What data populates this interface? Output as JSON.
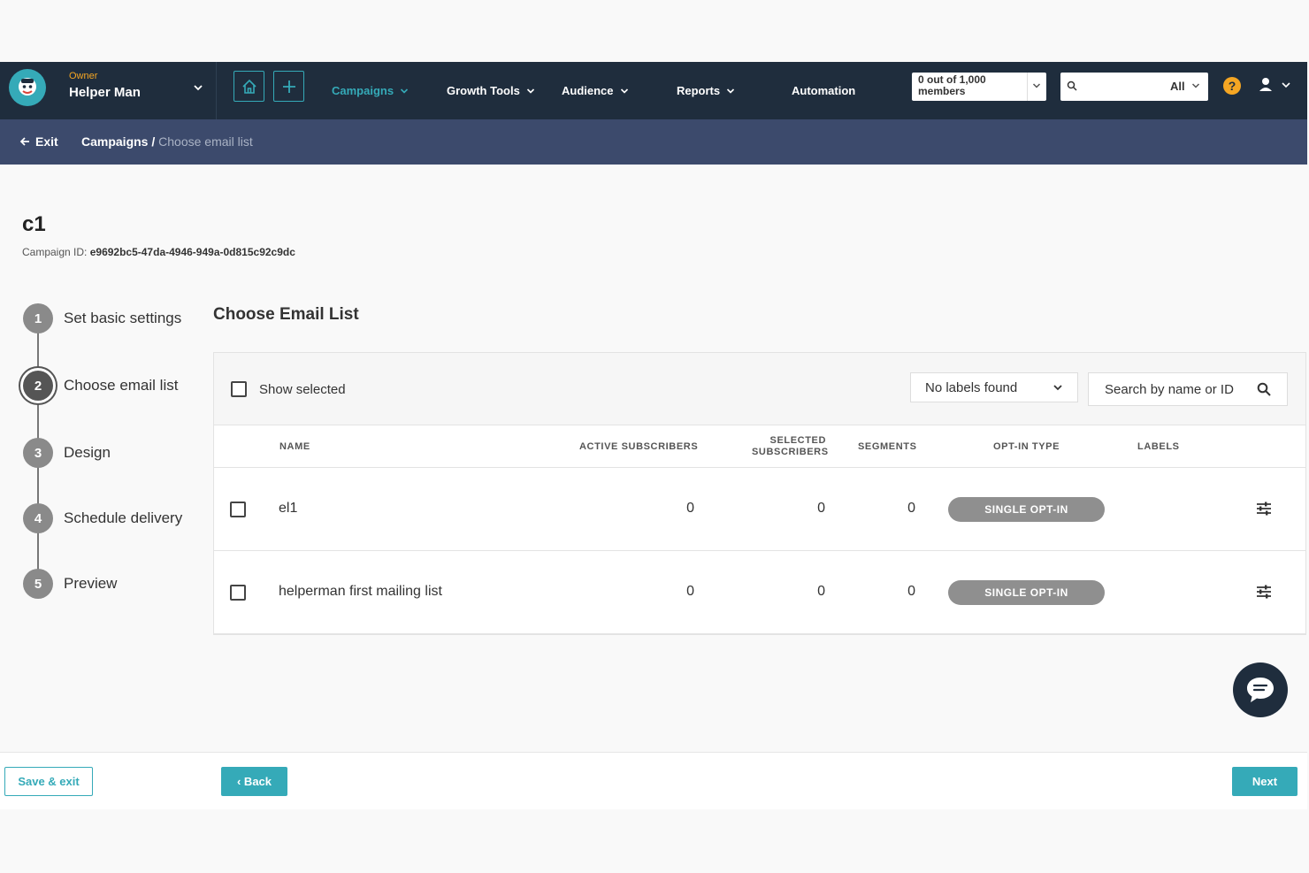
{
  "app": {
    "owner_label": "Owner",
    "owner_name": "Helper Man"
  },
  "nav": {
    "items": [
      {
        "label": "Campaigns",
        "active": true,
        "has_dropdown": true
      },
      {
        "label": "Growth Tools",
        "has_dropdown": true
      },
      {
        "label": "Audience",
        "has_dropdown": true
      },
      {
        "label": "Reports",
        "has_dropdown": true
      },
      {
        "label": "Automation",
        "has_dropdown": false
      }
    ],
    "members": "0 out of 1,000 members",
    "search_scope": "All",
    "help_label": "?"
  },
  "breadcrumb": {
    "exit_label": "Exit",
    "parent": "Campaigns",
    "separator": " / ",
    "current": "Choose email list"
  },
  "campaign": {
    "title": "c1",
    "id_label": "Campaign ID:",
    "id_value": "e9692bc5-47da-4946-949a-0d815c92c9dc"
  },
  "steps": [
    {
      "num": "1",
      "label": "Set basic settings"
    },
    {
      "num": "2",
      "label": "Choose email list",
      "active": true
    },
    {
      "num": "3",
      "label": "Design"
    },
    {
      "num": "4",
      "label": "Schedule delivery"
    },
    {
      "num": "5",
      "label": "Preview"
    }
  ],
  "list_section": {
    "title": "Choose Email List",
    "show_selected_label": "Show selected",
    "labels_filter": "No labels found",
    "search_placeholder": "Search by name or ID"
  },
  "table": {
    "columns": {
      "name": "NAME",
      "active": "ACTIVE SUBSCRIBERS",
      "selected_1": "SELECTED",
      "selected_2": "SUBSCRIBERS",
      "segments": "SEGMENTS",
      "optin": "OPT-IN TYPE",
      "labels": "LABELS"
    },
    "rows": [
      {
        "name": "el1",
        "active": "0",
        "selected": "0",
        "segments": "0",
        "optin": "SINGLE OPT-IN"
      },
      {
        "name": "helperman first mailing list",
        "active": "0",
        "selected": "0",
        "segments": "0",
        "optin": "SINGLE OPT-IN"
      }
    ]
  },
  "footer": {
    "save_exit": "Save & exit",
    "back": "‹ Back",
    "next": "Next"
  },
  "colors": {
    "nav_bg": "#1f2d3d",
    "crumb_bg": "#3c4a6c",
    "accent": "#35aab8",
    "owner": "#f5a623",
    "pill": "#8f8f8f"
  }
}
